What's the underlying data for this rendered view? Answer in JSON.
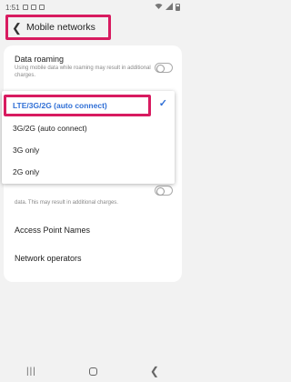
{
  "status_bar": {
    "time": "1:51"
  },
  "header": {
    "title": "Mobile networks"
  },
  "data_roaming": {
    "title": "Data roaming",
    "description": "Using mobile data while roaming may result in additional charges."
  },
  "network_mode_menu": {
    "options": [
      {
        "label": "LTE/3G/2G (auto connect)",
        "selected": true
      },
      {
        "label": "3G/2G (auto connect)",
        "selected": false
      },
      {
        "label": "3G only",
        "selected": false
      },
      {
        "label": "2G only",
        "selected": false
      }
    ]
  },
  "partial_setting_desc": "data. This may result in additional charges.",
  "settings": {
    "access_point_names": "Access Point Names",
    "network_operators": "Network operators"
  },
  "colors": {
    "accent": "#2f6fd6",
    "highlight": "#d81b60"
  },
  "icons": {
    "back": "back-arrow-icon",
    "check": "check-icon",
    "nav_recent": "recent-apps-icon",
    "nav_home": "home-icon",
    "nav_back": "back-icon"
  }
}
